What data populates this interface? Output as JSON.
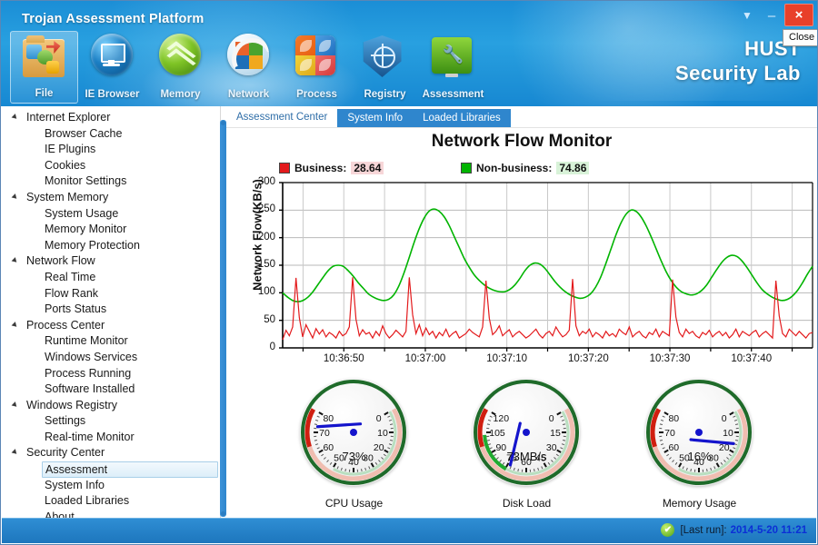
{
  "window": {
    "title": "Trojan Assessment Platform",
    "brand_line1": "HUST",
    "brand_line2": "Security Lab",
    "dropdown_icon": "chevron-down-icon",
    "minimize_label": "–",
    "close_label": "×",
    "close_tooltip": "Close"
  },
  "toolbar": [
    {
      "label": "File",
      "icon": "folder-icon",
      "selected": true
    },
    {
      "label": "IE Browser",
      "icon": "monitor-icon",
      "selected": false
    },
    {
      "label": "Memory",
      "icon": "chevron-up-icon",
      "selected": false
    },
    {
      "label": "Network",
      "icon": "network-icon",
      "selected": false
    },
    {
      "label": "Process",
      "icon": "squares-icon",
      "selected": false
    },
    {
      "label": "Registry",
      "icon": "shield-icon",
      "selected": false
    },
    {
      "label": "Assessment",
      "icon": "wrench-monitor-icon",
      "selected": false
    }
  ],
  "sidebar": {
    "groups": [
      {
        "label": "Internet Explorer",
        "items": [
          "Browser Cache",
          "IE Plugins",
          "Cookies",
          "Monitor Settings"
        ]
      },
      {
        "label": "System Memory",
        "items": [
          "System Usage",
          "Memory Monitor",
          "Memory Protection"
        ]
      },
      {
        "label": "Network Flow",
        "items": [
          "Real Time",
          "Flow Rank",
          "Ports Status"
        ]
      },
      {
        "label": "Process Center",
        "items": [
          "Runtime Monitor",
          "Windows Services",
          "Process Running",
          "Software Installed"
        ]
      },
      {
        "label": "Windows Registry",
        "items": [
          "Settings",
          "Real-time Monitor"
        ]
      },
      {
        "label": "Security Center",
        "items": [
          "Assessment",
          "System Info",
          "Loaded Libraries",
          "About"
        ]
      }
    ],
    "selected_item": "Assessment"
  },
  "tabs": [
    {
      "label": "Assessment Center",
      "active": true
    },
    {
      "label": "System Info",
      "active": false
    },
    {
      "label": "Loaded Libraries",
      "active": false
    }
  ],
  "panel": {
    "title": "Network Flow Monitor"
  },
  "legend": {
    "business_label": "Business:",
    "business_value": "28.64",
    "business_color": "#e31a1c",
    "nonbusiness_label": "Non-business:",
    "nonbusiness_value": "74.86",
    "nonbusiness_color": "#00b400"
  },
  "chart_data": {
    "type": "line",
    "title": "Network Flow Monitor",
    "xlabel": "",
    "ylabel": "Network Flow(KB/s)",
    "ylim": [
      0,
      300
    ],
    "yticks": [
      0,
      50,
      100,
      150,
      200,
      250,
      300
    ],
    "xticks": [
      "10:36:50",
      "10:37:00",
      "10:37:10",
      "10:37:20",
      "10:37:30",
      "10:37:40"
    ],
    "grid": true,
    "legend_position": "top",
    "series": [
      {
        "name": "Business",
        "color": "#e31a1c",
        "current_value": 28.64,
        "values": [
          15,
          32,
          22,
          38,
          127,
          55,
          20,
          42,
          30,
          18,
          35,
          25,
          33,
          20,
          28,
          24,
          18,
          30,
          22,
          26,
          38,
          128,
          52,
          22,
          33,
          25,
          28,
          18,
          30,
          22,
          40,
          26,
          18,
          24,
          32,
          26,
          20,
          30,
          128,
          60,
          26,
          42,
          22,
          36,
          24,
          30,
          18,
          28,
          22,
          34,
          20,
          26,
          30,
          18,
          22,
          26,
          34,
          28,
          24,
          20,
          38,
          122,
          54,
          24,
          30,
          40,
          22,
          28,
          33,
          20,
          26,
          30,
          24,
          18,
          22,
          28,
          34,
          24,
          18,
          26,
          30,
          22,
          38,
          28,
          20,
          24,
          32,
          125,
          40,
          22,
          30,
          26,
          34,
          20,
          28,
          24,
          18,
          30,
          22,
          26,
          20,
          34,
          28,
          24,
          38,
          20,
          26,
          30,
          22,
          18,
          28,
          24,
          34,
          20,
          30,
          26,
          22,
          124,
          56,
          28,
          20,
          34,
          26,
          30,
          22,
          18,
          28,
          24,
          32,
          20,
          26,
          30,
          22,
          28,
          18,
          24,
          34,
          20,
          30,
          26,
          22,
          28,
          32,
          20,
          26,
          30,
          24,
          18,
          122,
          58,
          26,
          20,
          34,
          28,
          22,
          30,
          24,
          18,
          26,
          28
        ]
      },
      {
        "name": "Non-business",
        "color": "#00b400",
        "current_value": 74.86,
        "values": [
          100,
          92,
          86,
          84,
          86,
          92,
          102,
          115,
          128,
          140,
          148,
          150,
          148,
          140,
          130,
          118,
          108,
          98,
          92,
          88,
          86,
          88,
          96,
          112,
          135,
          162,
          190,
          215,
          235,
          248,
          252,
          248,
          238,
          222,
          202,
          182,
          162,
          146,
          132,
          122,
          114,
          108,
          104,
          102,
          102,
          106,
          114,
          126,
          140,
          150,
          154,
          152,
          144,
          132,
          120,
          110,
          102,
          96,
          92,
          90,
          92,
          98,
          110,
          128,
          152,
          178,
          204,
          226,
          242,
          250,
          248,
          238,
          222,
          202,
          180,
          158,
          138,
          122,
          110,
          102,
          98,
          96,
          98,
          104,
          114,
          128,
          142,
          155,
          164,
          168,
          166,
          158,
          146,
          132,
          118,
          106,
          98,
          92,
          88,
          86,
          88,
          94,
          104,
          118,
          134,
          148
        ]
      }
    ]
  },
  "gauges": [
    {
      "caption": "CPU Usage",
      "reading": "73%",
      "min": 0,
      "max": 80,
      "step": 10,
      "ticks": [
        "0",
        "10",
        "20",
        "30",
        "40",
        "50",
        "60",
        "70",
        "80"
      ],
      "value": 73,
      "needle_color": "#1414cc"
    },
    {
      "caption": "Disk Load",
      "reading": "73MB/s",
      "min": 0,
      "max": 120,
      "step": 15,
      "ticks": [
        "0",
        "15",
        "30",
        "45",
        "60",
        "75",
        "90",
        "105",
        "120"
      ],
      "value": 73,
      "needle_color": "#1414cc"
    },
    {
      "caption": "Memory Usage",
      "reading": "16%",
      "min": 0,
      "max": 80,
      "step": 10,
      "ticks": [
        "0",
        "10",
        "20",
        "30",
        "40",
        "50",
        "60",
        "70",
        "80"
      ],
      "value": 16,
      "needle_color": "#1414cc"
    }
  ],
  "statusbar": {
    "check_icon": "check-icon",
    "check_glyph": "✔",
    "last_run_label": "[Last run]:",
    "last_run_value": "2014-5-20 11:21"
  }
}
